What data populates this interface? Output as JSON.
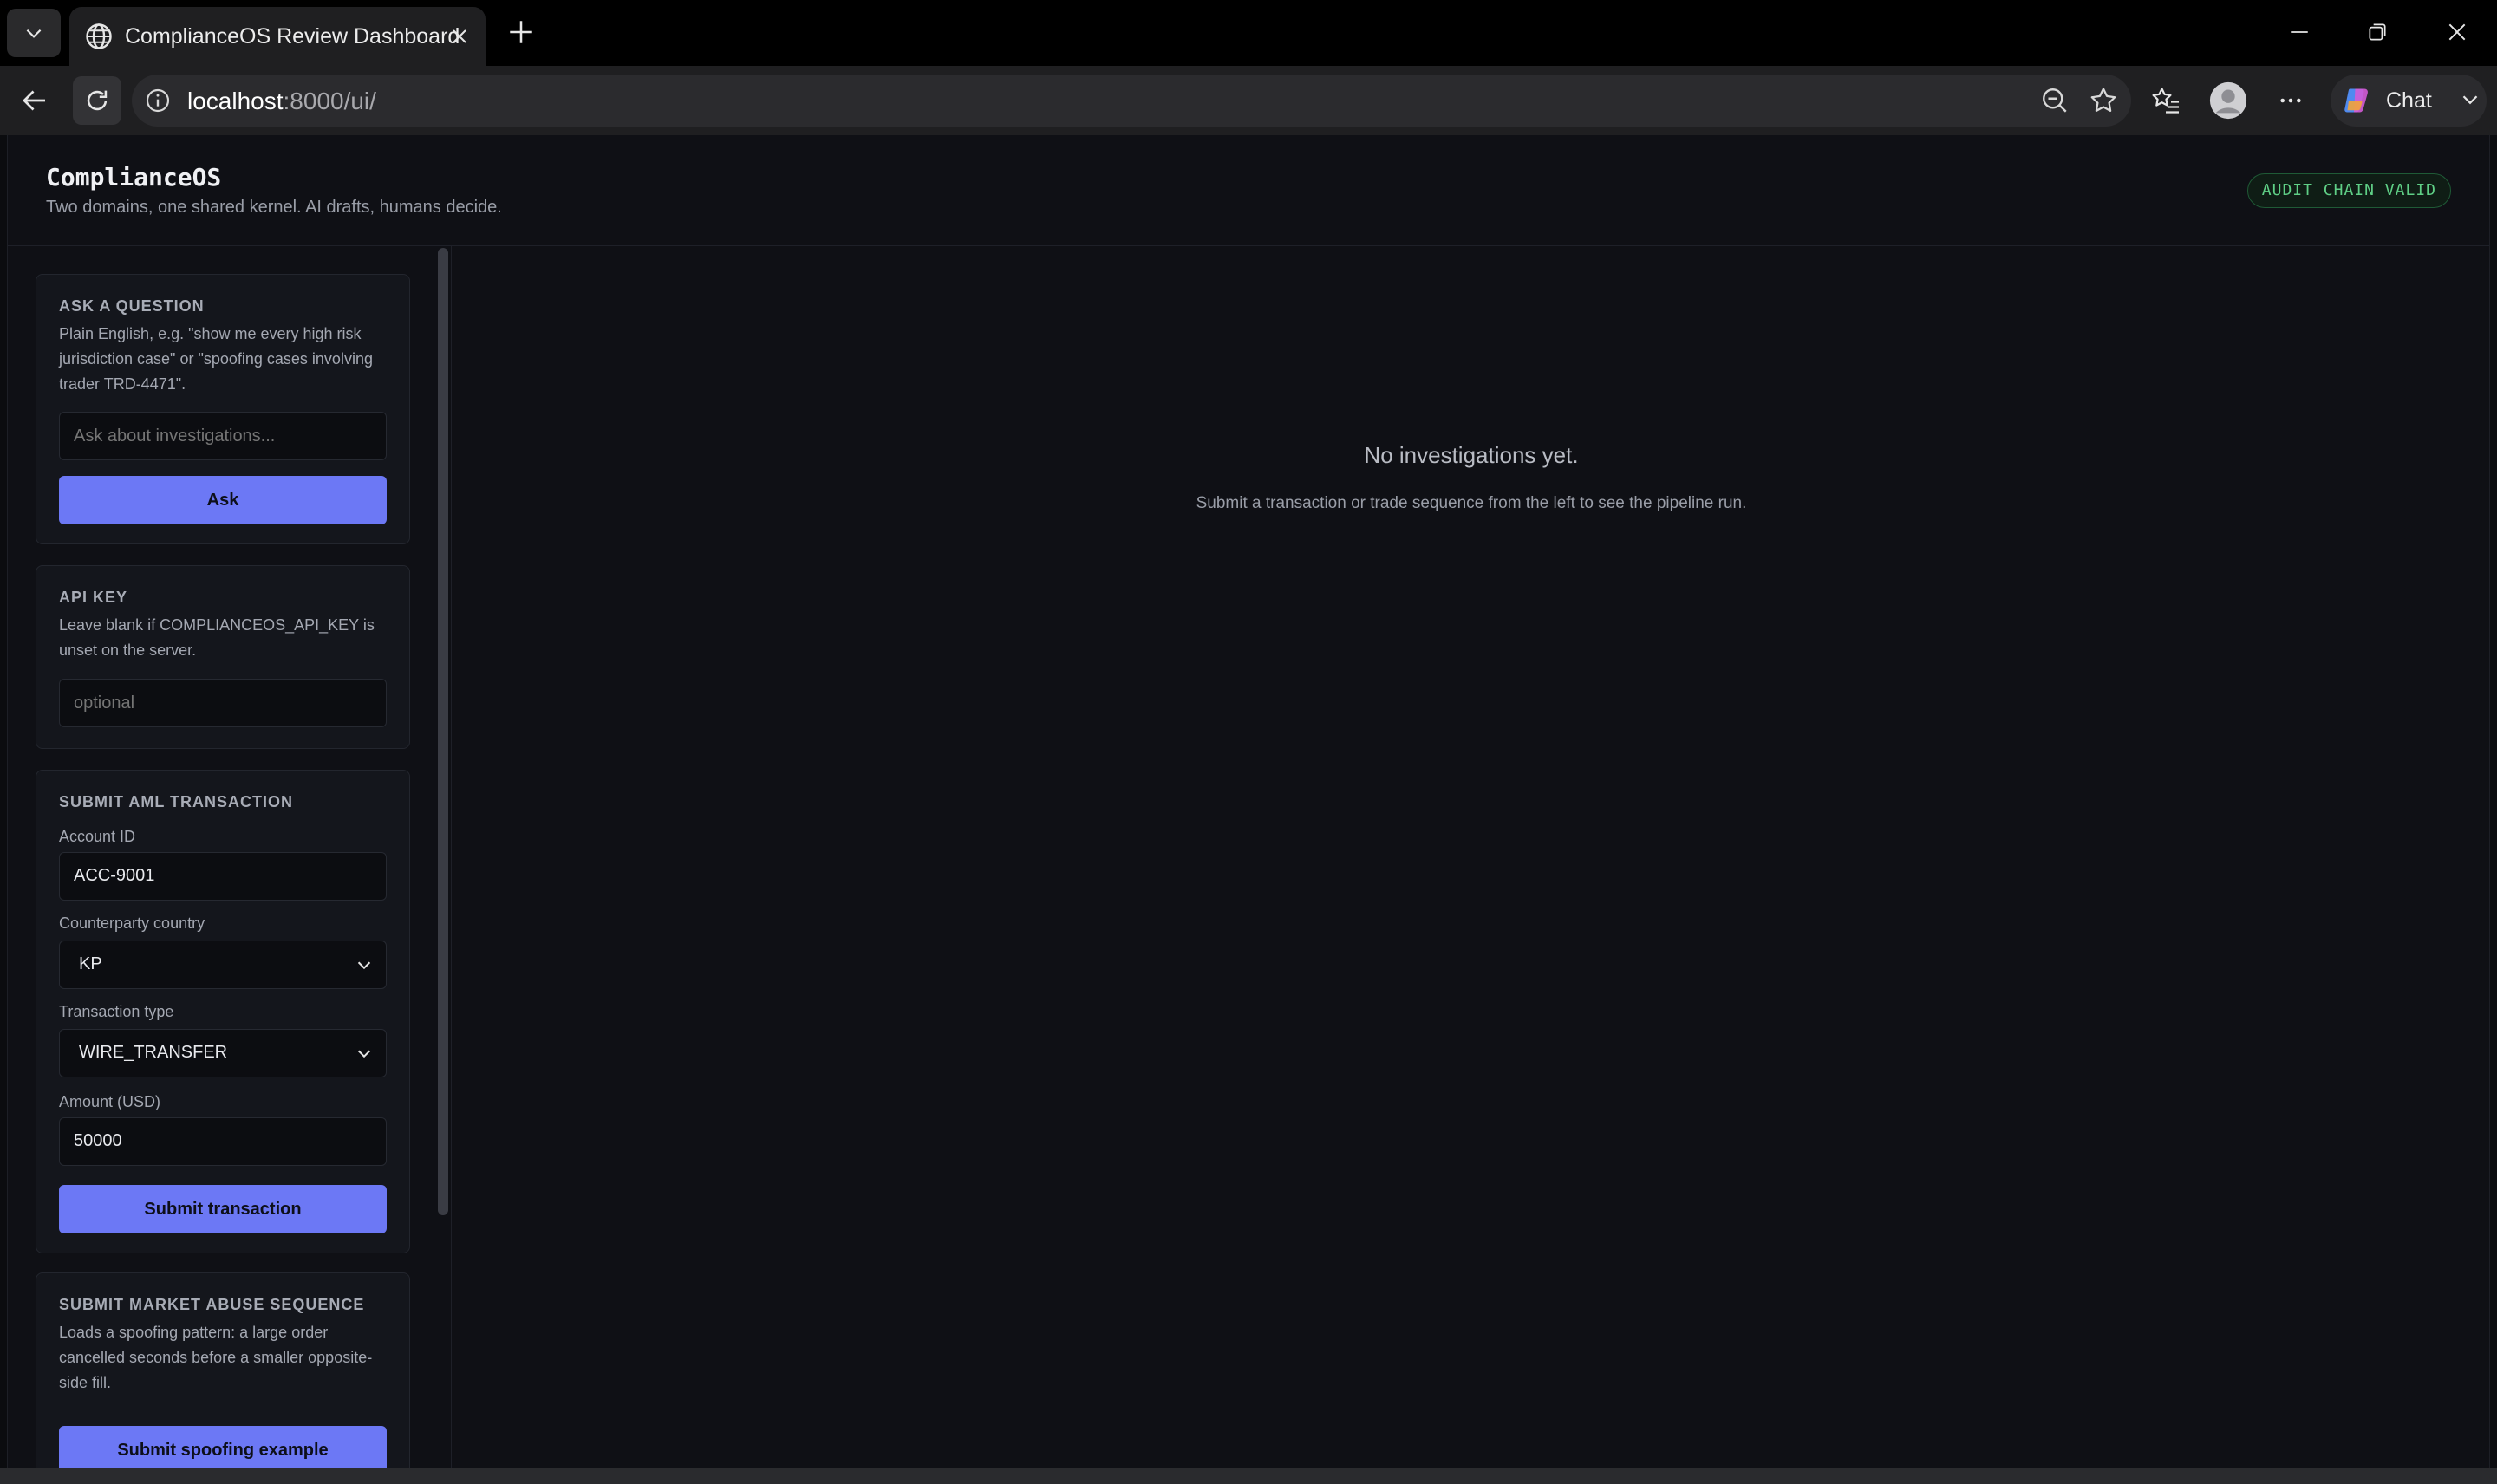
{
  "browser": {
    "tab_title": "ComplianceOS Review Dashboard",
    "url_host": "localhost",
    "url_path": ":8000/ui/",
    "chat_label": "Chat"
  },
  "header": {
    "brand": "ComplianceOS",
    "tagline": "Two domains, one shared kernel. AI drafts, humans decide.",
    "audit_badge": "AUDIT CHAIN VALID"
  },
  "ask": {
    "title": "ASK A QUESTION",
    "description": "Plain English, e.g. \"show me every high risk jurisdiction case\" or \"spoofing cases involving trader TRD-4471\".",
    "placeholder": "Ask about investigations...",
    "button": "Ask"
  },
  "api_key": {
    "title": "API KEY",
    "description": "Leave blank if COMPLIANCEOS_API_KEY is unset on the server.",
    "placeholder": "optional"
  },
  "aml": {
    "title": "SUBMIT AML TRANSACTION",
    "account_label": "Account ID",
    "account_value": "ACC-9001",
    "country_label": "Counterparty country",
    "country_value": "KP",
    "type_label": "Transaction type",
    "type_value": "WIRE_TRANSFER",
    "amount_label": "Amount (USD)",
    "amount_value": "50000",
    "button": "Submit transaction"
  },
  "market_abuse": {
    "title": "SUBMIT MARKET ABUSE SEQUENCE",
    "description": "Loads a spoofing pattern: a large order cancelled seconds before a smaller opposite-side fill.",
    "button": "Submit spoofing example"
  },
  "main": {
    "empty_title": "No investigations yet.",
    "empty_subtitle": "Submit a transaction or trade sequence from the left to see the pipeline run."
  },
  "colors": {
    "accent": "#6c78f5",
    "badge_text": "#5fcf86",
    "background": "#0f1015"
  }
}
